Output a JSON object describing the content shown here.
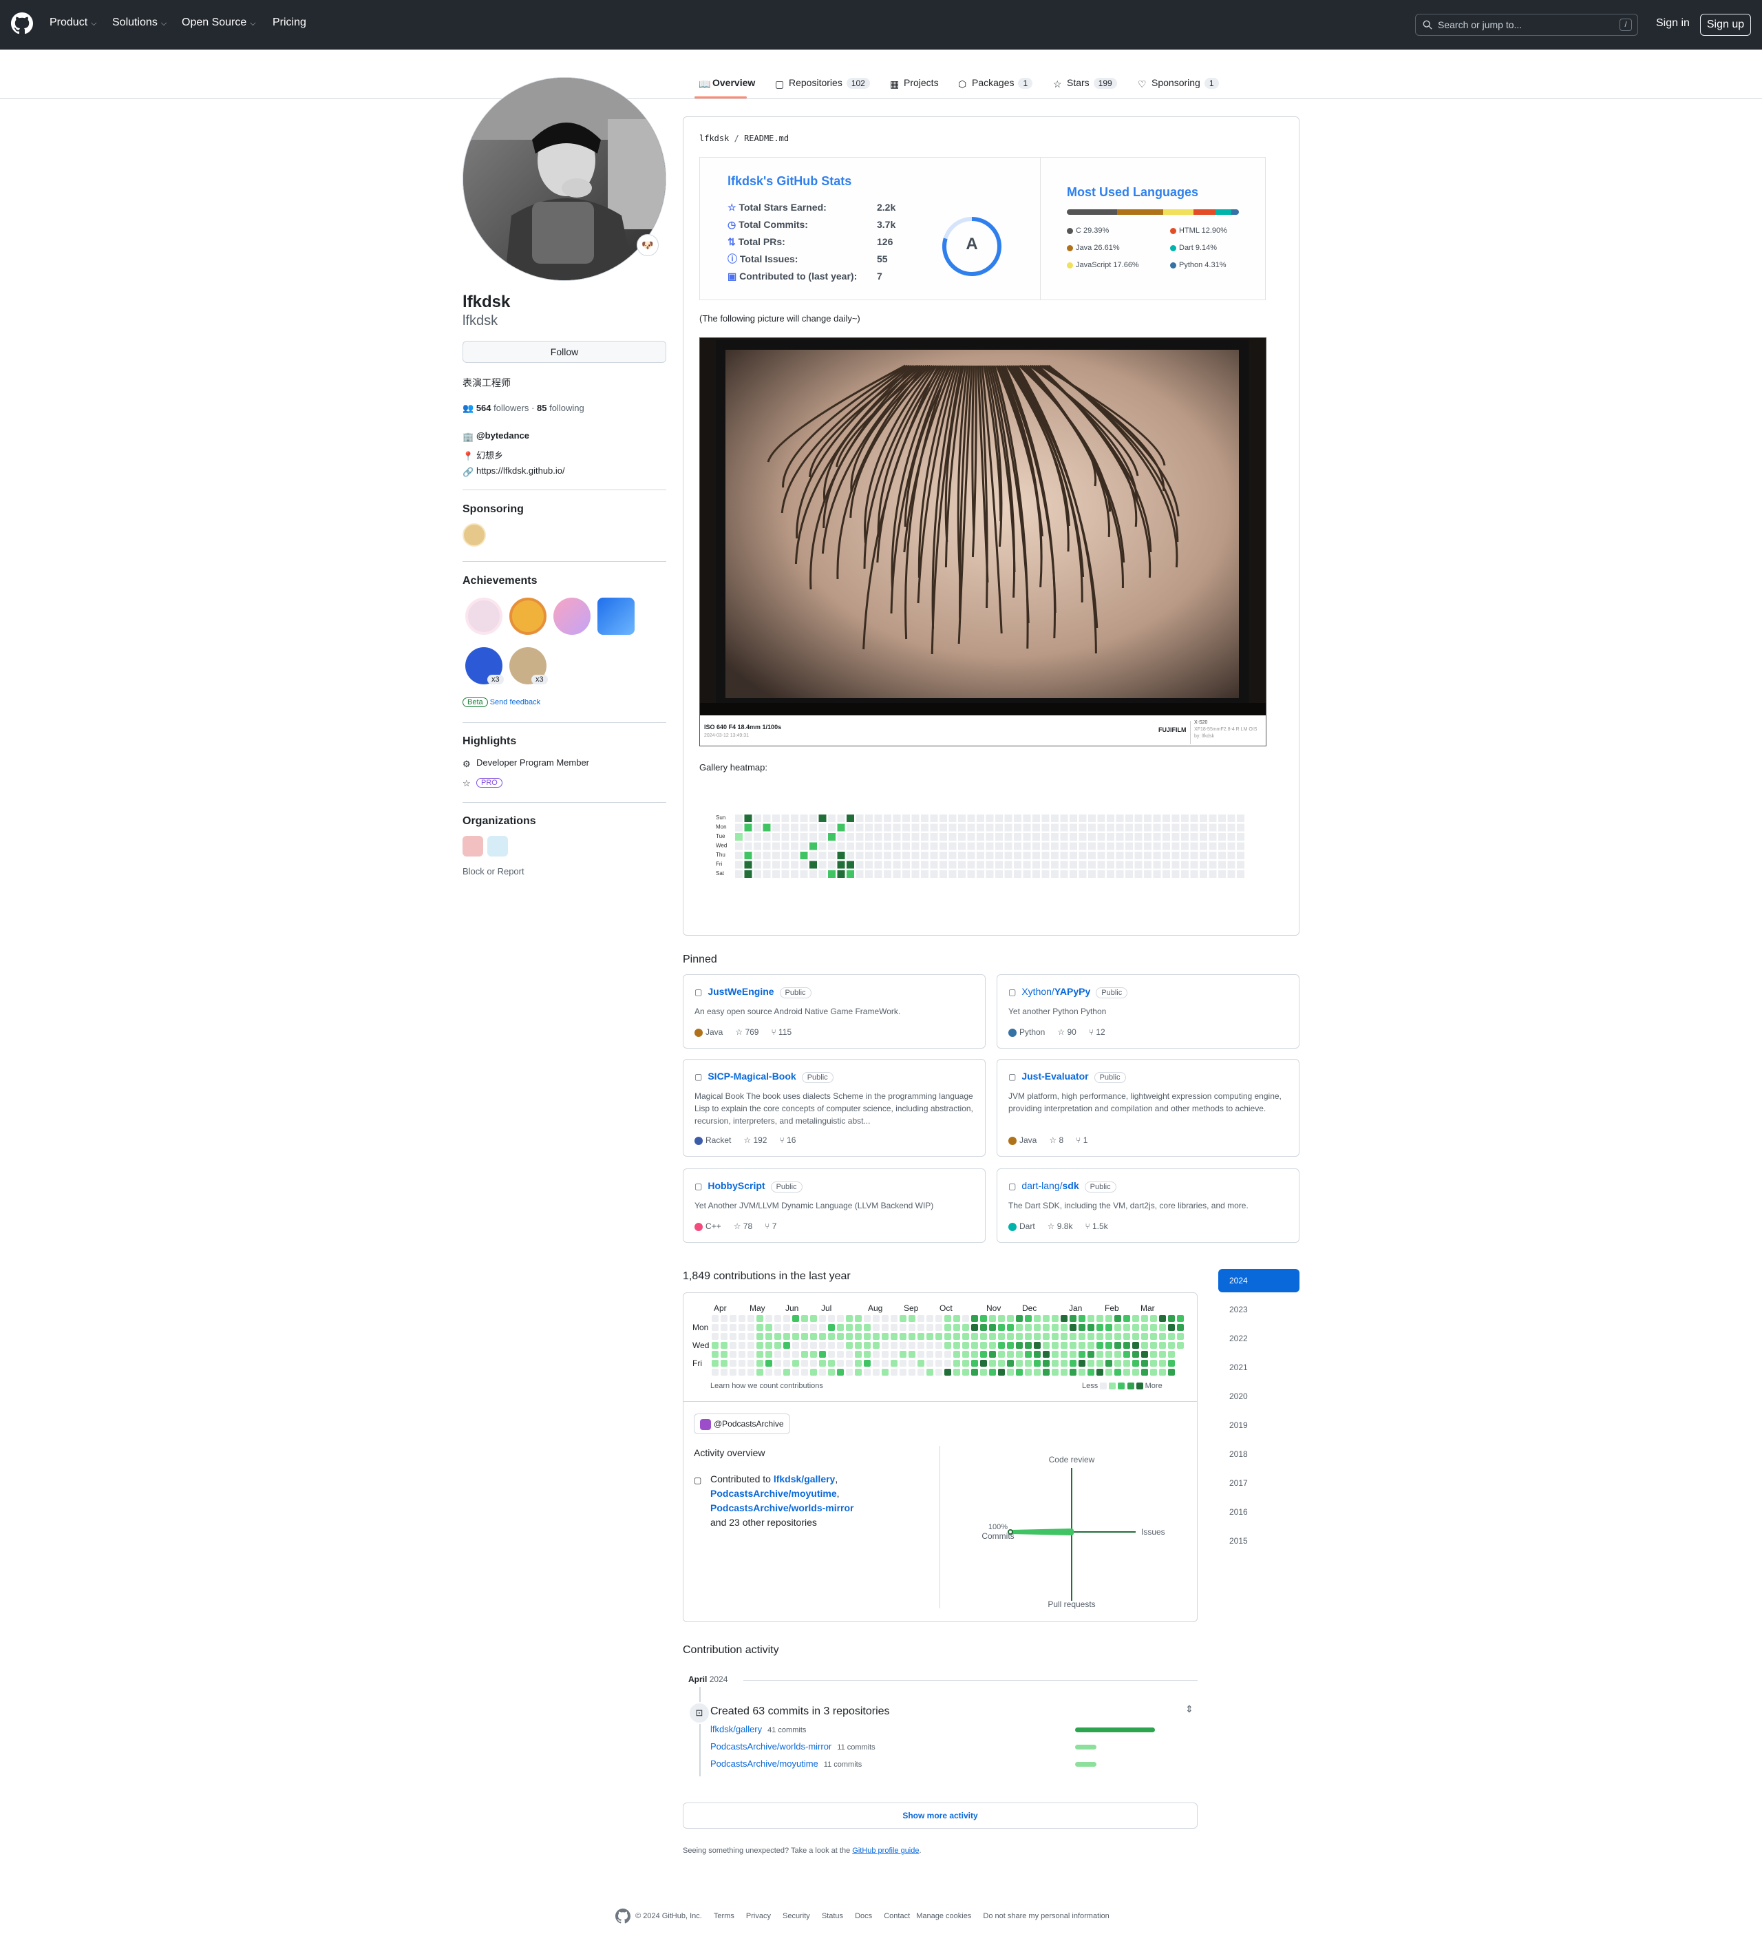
{
  "header": {
    "nav": [
      "Product",
      "Solutions",
      "Open Source",
      "Pricing"
    ],
    "search_placeholder": "Search or jump to...",
    "slash": "/",
    "signin": "Sign in",
    "signup": "Sign up"
  },
  "tabs": [
    {
      "label": "Overview"
    },
    {
      "label": "Repositories",
      "count": "102"
    },
    {
      "label": "Projects"
    },
    {
      "label": "Packages",
      "count": "1"
    },
    {
      "label": "Stars",
      "count": "199"
    },
    {
      "label": "Sponsoring",
      "count": "1"
    }
  ],
  "profile": {
    "name": "lfkdsk",
    "login": "lfkdsk",
    "follow": "Follow",
    "bio": "表演工程师",
    "followers": "564",
    "followers_label": "followers",
    "dot": "·",
    "following": "85",
    "following_label": "following",
    "company": "@bytedance",
    "location": "幻想乡",
    "website": "https://lfkdsk.github.io/"
  },
  "sidebar": {
    "sponsoring_title": "Sponsoring",
    "achievements_title": "Achievements",
    "x3a": "x3",
    "x3b": "x3",
    "beta": "Beta",
    "feedback": "Send feedback",
    "highlights_title": "Highlights",
    "dev_program": "Developer Program Member",
    "pro": "PRO",
    "orgs_title": "Organizations",
    "block": "Block or Report"
  },
  "readme": {
    "path_user": "lfkdsk",
    "path_sep": "/",
    "path_file": "README.md",
    "stats_title": "lfkdsk's GitHub Stats",
    "stats": [
      {
        "label": "Total Stars Earned:",
        "value": "2.2k"
      },
      {
        "label": "Total Commits:",
        "value": "3.7k"
      },
      {
        "label": "Total PRs:",
        "value": "126"
      },
      {
        "label": "Total Issues:",
        "value": "55"
      },
      {
        "label": "Contributed to (last year):",
        "value": "7"
      }
    ],
    "grade": "A",
    "langs_title": "Most Used Languages",
    "langs": [
      {
        "name": "C 29.39%",
        "color": "#555555"
      },
      {
        "name": "HTML 12.90%",
        "color": "#e34c26"
      },
      {
        "name": "Java 26.61%",
        "color": "#b07219"
      },
      {
        "name": "Dart 9.14%",
        "color": "#00B4AB"
      },
      {
        "name": "JavaScript 17.66%",
        "color": "#f1e05a"
      },
      {
        "name": "Python 4.31%",
        "color": "#3572A5"
      }
    ],
    "note": "(The following picture will change daily~)",
    "photo_caption": "ISO 640 F4 18.4mm 1/100s",
    "photo_date": "2024-03-12 13:49:31",
    "brand": "FUJIFILM",
    "camera": "X-S20",
    "lens": "XF18-55mmF2.8-4 R LM OIS",
    "author": "by: lfkdsk",
    "heatmap_label": "Gallery heatmap:",
    "heat_days": [
      "Sun",
      "Mon",
      "Tue",
      "Wed",
      "Thu",
      "Fri",
      "Sat"
    ]
  },
  "pinned_title": "Pinned",
  "pinned": [
    {
      "owner": "",
      "name": "JustWeEngine",
      "vis": "Public",
      "desc": "An easy open source Android Native Game FrameWork.",
      "lang": "Java",
      "lang_color": "#b07219",
      "stars": "769",
      "forks": "115"
    },
    {
      "owner": "Xython/",
      "name": "YAPyPy",
      "vis": "Public",
      "desc": "Yet another Python Python",
      "lang": "Python",
      "lang_color": "#3572A5",
      "stars": "90",
      "forks": "12"
    },
    {
      "owner": "",
      "name": "SICP-Magical-Book",
      "vis": "Public",
      "desc": "Magical Book The book uses dialects Scheme in the programming language Lisp to explain the core concepts of computer science, including abstraction, recursion, interpreters, and metalinguistic abst...",
      "lang": "Racket",
      "lang_color": "#3c5caa",
      "stars": "192",
      "forks": "16"
    },
    {
      "owner": "",
      "name": "Just-Evaluator",
      "vis": "Public",
      "desc": "JVM platform, high performance, lightweight expression computing engine, providing interpretation and compilation and other methods to achieve.",
      "lang": "Java",
      "lang_color": "#b07219",
      "stars": "8",
      "forks": "1"
    },
    {
      "owner": "",
      "name": "HobbyScript",
      "vis": "Public",
      "desc": "Yet Another JVM/LLVM Dynamic Language (LLVM Backend WIP)",
      "lang": "C++",
      "lang_color": "#f34b7d",
      "stars": "78",
      "forks": "7"
    },
    {
      "owner": "dart-lang/",
      "name": "sdk",
      "vis": "Public",
      "desc": "The Dart SDK, including the VM, dart2js, core libraries, and more.",
      "lang": "Dart",
      "lang_color": "#00B4AB",
      "stars": "9.8k",
      "forks": "1.5k"
    }
  ],
  "contrib": {
    "title": "1,849 contributions in the last year",
    "months": [
      "Apr",
      "May",
      "Jun",
      "Jul",
      "Aug",
      "Sep",
      "Oct",
      "Nov",
      "Dec",
      "Jan",
      "Feb",
      "Mar"
    ],
    "days": [
      "Mon",
      "Wed",
      "Fri"
    ],
    "learn": "Learn how we count contributions",
    "less": "Less",
    "more": "More",
    "org": "@PodcastsArchive",
    "overview_title": "Activity overview",
    "contributed_to": "Contributed to",
    "repo1": "lfkdsk/gallery",
    "repo2": "PodcastsArchive/moyutime",
    "repo3": "PodcastsArchive/worlds-mirror",
    "comma": ",",
    "others": "and 23 other repositories",
    "axis_top": "Code review",
    "axis_right": "Issues",
    "axis_bottom": "Pull requests",
    "axis_left_pct": "100%",
    "axis_left": "Commits",
    "years": [
      "2024",
      "2023",
      "2022",
      "2021",
      "2020",
      "2019",
      "2018",
      "2017",
      "2016",
      "2015"
    ],
    "selected_year": "2024"
  },
  "activity": {
    "title": "Contribution activity",
    "month": "April",
    "year": "2024",
    "created": "Created 63 commits in 3 repositories",
    "rows": [
      {
        "repo": "lfkdsk/gallery",
        "commits": "41 commits",
        "fill": 1.0
      },
      {
        "repo": "PodcastsArchive/worlds-mirror",
        "commits": "11 commits",
        "fill": 0.27
      },
      {
        "repo": "PodcastsArchive/moyutime",
        "commits": "11 commits",
        "fill": 0.27
      }
    ],
    "show_more": "Show more activity",
    "seeing": "Seeing something unexpected? Take a look at the",
    "guide": "GitHub profile guide",
    "period": "."
  },
  "footer": {
    "copy": "© 2024 GitHub, Inc.",
    "links": [
      "Terms",
      "Privacy",
      "Security",
      "Status",
      "Docs",
      "Contact",
      "Manage cookies",
      "Do not share my personal information"
    ]
  }
}
